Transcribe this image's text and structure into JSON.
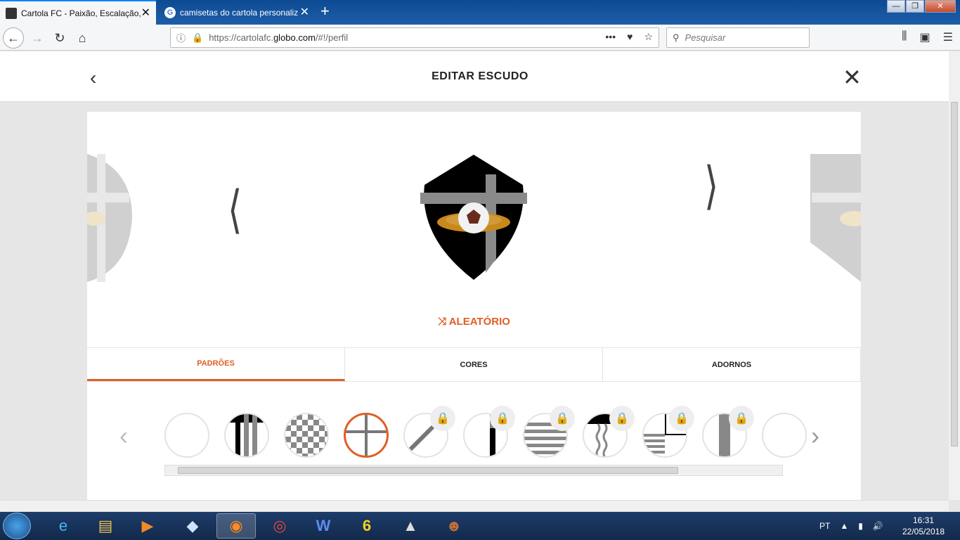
{
  "browser": {
    "tabs": [
      {
        "label": "Cartola FC - Paixão, Escalação,",
        "active": true
      },
      {
        "label": "camisetas do cartola personaliz",
        "active": false
      }
    ],
    "url_prefix": "https://cartolafc.",
    "url_domain": "globo.com",
    "url_path": "/#!/perfil",
    "search_placeholder": "Pesquisar",
    "more_glyph": "•••",
    "window_buttons": [
      "—",
      "❐",
      "✕"
    ]
  },
  "page": {
    "title": "EDITAR ESCUDO",
    "random_label": "ALEATÓRIO",
    "tabs": [
      {
        "label": "PADRÕES",
        "active": true
      },
      {
        "label": "CORES",
        "active": false
      },
      {
        "label": "ADORNOS",
        "active": false
      }
    ],
    "patterns": [
      {
        "name": "plain",
        "locked": false,
        "selected": false
      },
      {
        "name": "vertical-stripes",
        "locked": false,
        "selected": false
      },
      {
        "name": "checkered",
        "locked": false,
        "selected": false
      },
      {
        "name": "cross",
        "locked": false,
        "selected": true
      },
      {
        "name": "diagonal-sash",
        "locked": true,
        "selected": false
      },
      {
        "name": "half-stripe",
        "locked": true,
        "selected": false
      },
      {
        "name": "horizontal-stripes",
        "locked": true,
        "selected": false
      },
      {
        "name": "wavy-stripes",
        "locked": true,
        "selected": false
      },
      {
        "name": "quartered",
        "locked": true,
        "selected": false
      },
      {
        "name": "center-band",
        "locked": true,
        "selected": false
      }
    ],
    "colors": {
      "accent": "#e05e25",
      "shield": "#000000",
      "cross": "#808080",
      "ribbon": "#c8891a"
    }
  },
  "taskbar": {
    "apps": [
      "internet-explorer",
      "file-explorer",
      "media-player",
      "box-app",
      "firefox",
      "chrome",
      "word",
      "pes",
      "inkscape",
      "game-character"
    ],
    "lang": "PT",
    "time": "16:31",
    "date": "22/05/2018"
  }
}
